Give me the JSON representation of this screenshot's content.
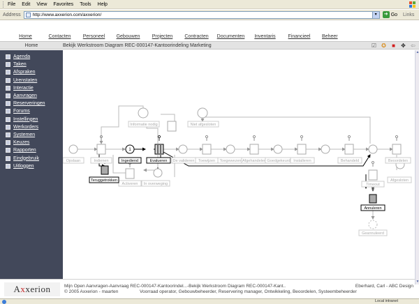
{
  "browser": {
    "menu": [
      "File",
      "Edit",
      "View",
      "Favorites",
      "Tools",
      "Help"
    ],
    "address_label": "Address",
    "address_value": "http://www.axxerion.com/axxerion/",
    "go_label": "Go",
    "links_label": "Links",
    "zone_label": "Local intranet"
  },
  "nav": {
    "items": [
      "Home",
      "Contacten",
      "Personeel",
      "Gebouwen",
      "Projecten",
      "Contracten",
      "Documenten",
      "Inventaris",
      "Financieel",
      "Beheer"
    ]
  },
  "crumb": {
    "home": "Home",
    "title": "Bekijk Werkstroom Diagram REC-000147-Kantoorindeling Marketing"
  },
  "sidebar": {
    "items": [
      {
        "label": "Agenda",
        "icon": "calendar-icon"
      },
      {
        "label": "Taken",
        "icon": "tasks-icon"
      },
      {
        "label": "Afspraken",
        "icon": "appointments-icon"
      },
      {
        "label": "Urenstaten",
        "icon": "timesheet-icon"
      },
      {
        "label": "Interactie",
        "icon": "interaction-icon"
      },
      {
        "label": "Aanvragen",
        "icon": "requests-icon"
      },
      {
        "label": "Reserveringen",
        "icon": "reservations-icon"
      },
      {
        "label": "Forums",
        "icon": "forums-icon"
      },
      {
        "label": "Instellingen",
        "icon": "settings-icon"
      },
      {
        "label": "Werkorders",
        "icon": "workorders-icon"
      },
      {
        "label": "Systemen",
        "icon": "systems-icon"
      },
      {
        "label": "Keuzes",
        "icon": "choices-icon"
      },
      {
        "label": "Rapporten",
        "icon": "reports-icon"
      },
      {
        "label": "Eindgebruik",
        "icon": "enduse-icon"
      },
      {
        "label": "Uitloggen",
        "icon": "logout-icon"
      }
    ]
  },
  "diagram": {
    "nodes": {
      "opslaan": "Opslaan",
      "indienen": "Indienen",
      "ingediend": "Ingediend",
      "evalueren": "Evalueren",
      "de_valideren": "De valideren",
      "toewijzen": "Toewijzen",
      "toegewezen": "Toegewezen",
      "afgehandelen": "Afgehandelen",
      "goedgekeurd": "Goedgekeurd",
      "installeren": "Installeren",
      "behandeld": "Behandeld",
      "beoordelen": "Beoordelen",
      "afgesloten": "Afgesloten",
      "informatie_nodig": "Informatie nodig",
      "niet_afgesloten": "Niet afgesloten",
      "teruggetrokken": "Teruggetrokken",
      "activeren": "Activeren",
      "in_overweging": "In overweging",
      "timeout": "Timeout",
      "annuleren": "Annuleren",
      "geannuleerd": "Geannuleerd"
    },
    "token_count": "1"
  },
  "footer": {
    "logo_a": "A",
    "logo_x": "x",
    "logo_rest": "xerion",
    "line1": "Mijn Open Aanvragen-Aanvraag REC-000147-Kantoorindel...-Bekijk Werkstroom Diagram REC-000147-Kant..",
    "line2": "© 2005 Axxerion - maarten",
    "user": "Eberhard, Carl - ABC Design",
    "roles": "Voorraad operator, Gebouwbeheerder, Reservering manager, Ontwikkeling, Beoordelen, Systeembeheerder"
  }
}
